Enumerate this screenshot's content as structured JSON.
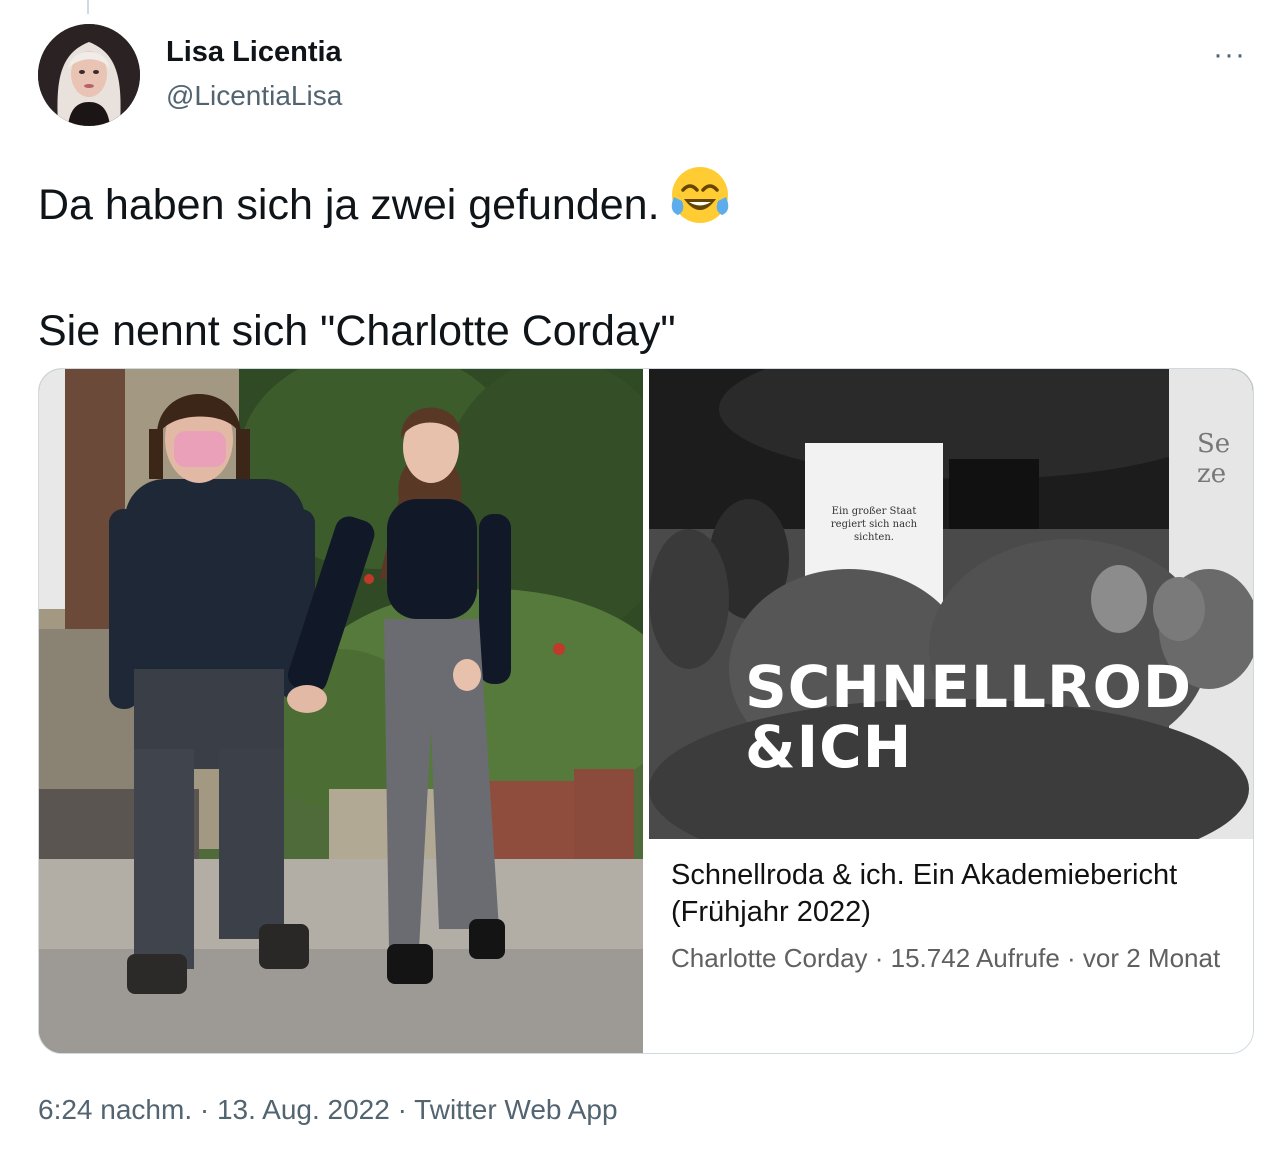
{
  "author": {
    "name": "Lisa Licentia",
    "handle": "@LicentiaLisa"
  },
  "icons": {
    "more": "more-options-icon",
    "emoji": "face-with-tears-of-joy-icon"
  },
  "more_label": "···",
  "tweet": {
    "line1": "Da haben sich ja zwei gefunden.",
    "line2": "Sie nennt sich \"Charlotte Corday\""
  },
  "media": {
    "right_card": {
      "thumb_title": "SCHNELLROD\n&ICH",
      "sign_text": "Ein großer Staat regiert sich nach sichten.",
      "corner_text": "Se ze",
      "video_title": "Schnellroda & ich. Ein Akademiebericht (Frühjahr 2022)",
      "video_meta": "Charlotte Corday · 15.742 Aufrufe · vor 2 Monat"
    }
  },
  "footer": {
    "timestamp": "6:24 nachm. · 13. Aug. 2022 · Twitter Web App"
  },
  "colors": {
    "text_primary": "#0f1419",
    "text_secondary": "#536471",
    "border": "#cfd9de"
  }
}
